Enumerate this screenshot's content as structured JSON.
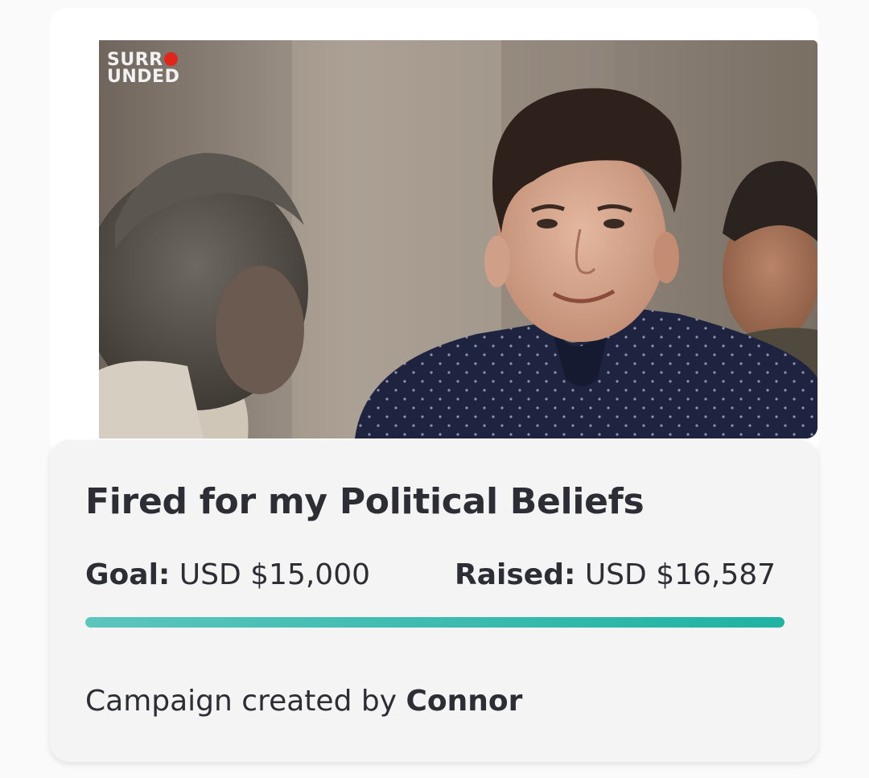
{
  "media": {
    "logo_line1": "SURR",
    "logo_line2": "UNDED",
    "logo_dot_color": "#e1251b",
    "photo_description_icon": "campaign-photo"
  },
  "campaign": {
    "title": "Fired for my Political Beliefs",
    "goal_label": "Goal:",
    "goal_value": "USD $15,000",
    "raised_label": "Raised:",
    "raised_value": "USD $16,587",
    "progress_percent": 100,
    "progress_color": "#1fb3a1",
    "creator_prefix": "Campaign created by",
    "creator_name": "Connor"
  }
}
